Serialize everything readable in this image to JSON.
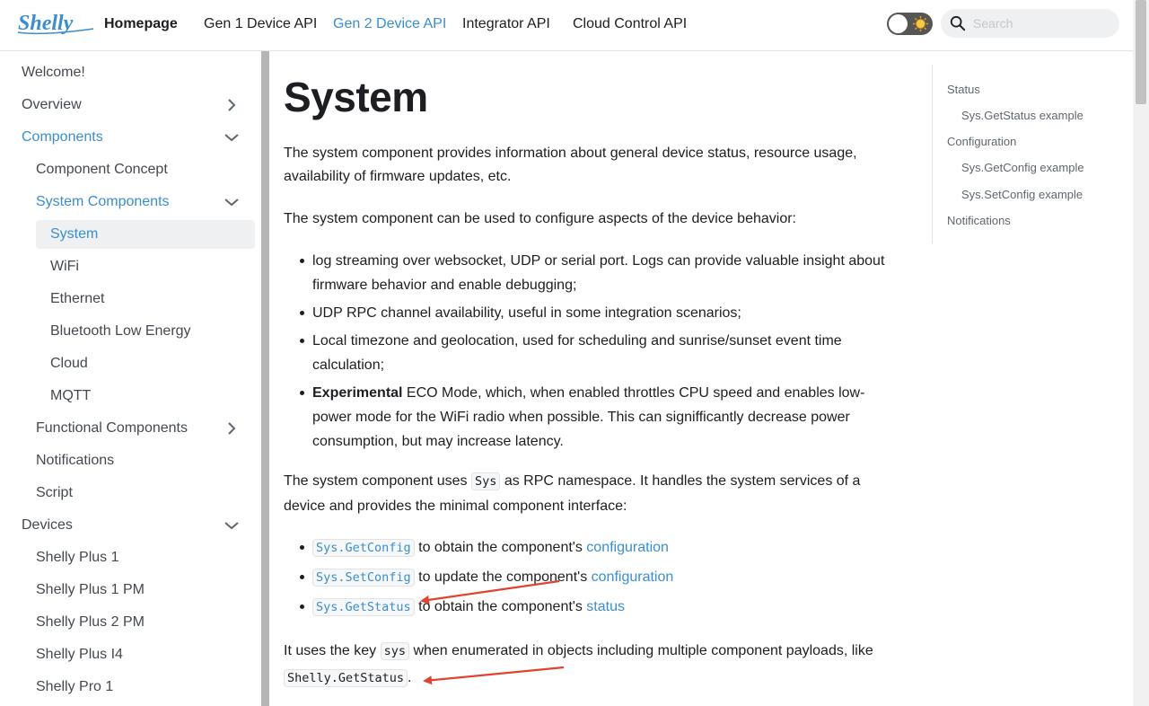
{
  "navbar": {
    "brand": "Shelly",
    "home": "Homepage",
    "links": [
      "Gen 1 Device API",
      "Gen 2 Device API",
      "Integrator API",
      "Cloud Control API"
    ],
    "search_placeholder": "Search",
    "accent": "#3a8ecf"
  },
  "sidebar": {
    "items": [
      {
        "label": "Welcome!"
      },
      {
        "label": "Overview"
      },
      {
        "label": "Components"
      },
      {
        "label": "Component Concept"
      },
      {
        "label": "System Components"
      },
      {
        "label": "System"
      },
      {
        "label": "WiFi"
      },
      {
        "label": "Ethernet"
      },
      {
        "label": "Bluetooth Low Energy"
      },
      {
        "label": "Cloud"
      },
      {
        "label": "MQTT"
      },
      {
        "label": "Functional Components"
      },
      {
        "label": "Notifications"
      },
      {
        "label": "Script"
      },
      {
        "label": "Devices"
      },
      {
        "label": "Shelly Plus 1"
      },
      {
        "label": "Shelly Plus 1 PM"
      },
      {
        "label": "Shelly Plus 2 PM"
      },
      {
        "label": "Shelly Plus I4"
      },
      {
        "label": "Shelly Pro 1"
      }
    ]
  },
  "main": {
    "title": "System",
    "p1": "The system component provides information about general device status, resource usage, availability of firmware updates, etc.",
    "p2": "The system component can be used to configure aspects of the device behavior:",
    "bullets": [
      "log streaming over websocket, UDP or serial port. Logs can provide valuable insight about firmware behavior and enable debugging;",
      "UDP RPC channel availability, useful in some integration scenarios;",
      "Local timezone and geolocation, used for scheduling and sunrise/sunset event time calculation;"
    ],
    "eco_bold": "Experimental",
    "eco_text": " ECO Mode, which, when enabled throttles CPU speed and enables low-power mode for the WiFi radio when possible. This can signifficantly decrease power consumption, but may increase latency.",
    "p3_a": "The system component uses ",
    "p3_code": "Sys",
    "p3_b": " as RPC namespace. It handles the system services of a device and provides the minimal component interface:",
    "methods": [
      {
        "code": "Sys.GetConfig",
        "text": " to obtain the component's ",
        "link": "configuration"
      },
      {
        "code": "Sys.SetConfig",
        "text": " to update the component's ",
        "link": "configuration"
      },
      {
        "code": "Sys.GetStatus",
        "text": " to obtain the component's ",
        "link": "status"
      }
    ],
    "p4_a": "It uses the key ",
    "p4_code": "sys",
    "p4_b": " when enumerated in objects including multiple component payloads, like ",
    "p4_code2": "Shelly.GetStatus",
    "p4_c": "."
  },
  "toc": {
    "items": [
      "Status",
      "Sys.GetStatus example",
      "Configuration",
      "Sys.GetConfig example",
      "Sys.SetConfig example",
      "Notifications"
    ]
  },
  "annotation_color": "#e0432f"
}
